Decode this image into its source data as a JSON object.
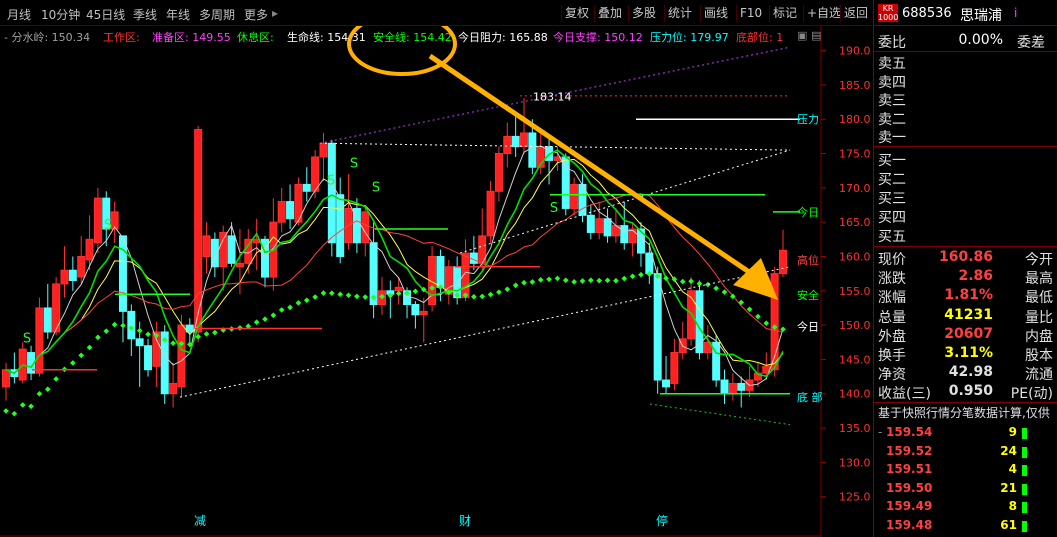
{
  "toolbar": {
    "periods": [
      "月线",
      "10分钟",
      "45日线",
      "季线",
      "年线",
      "多周期",
      "更多"
    ],
    "more_arrow": "▸",
    "buttons": [
      "复权",
      "叠加",
      "多股",
      "统计",
      "画线",
      "F10",
      "标记",
      "+自选",
      "返回"
    ]
  },
  "indicators": [
    {
      "text": "- 分水岭: 150.34",
      "color": "#a0a0a0"
    },
    {
      "text": "工作区:",
      "color": "#ff3030"
    },
    {
      "text": "准备区: 149.55",
      "color": "#ff40ff"
    },
    {
      "text": "休息区:",
      "color": "#00ff00"
    },
    {
      "text": "生命线: 154.31",
      "color": "#ffffff"
    },
    {
      "text": "安全线: 154.42",
      "color": "#00ff00"
    },
    {
      "text": "今日阻力: 165.88",
      "color": "#ffffff"
    },
    {
      "text": "今日支撑: 150.12",
      "color": "#ff40ff"
    },
    {
      "text": "压力位: 179.97",
      "color": "#00ffff"
    },
    {
      "text": "底部位: 1",
      "color": "#ff3030"
    }
  ],
  "chart_data": {
    "type": "candlestick",
    "ylim": [
      120,
      193
    ],
    "y_ticks": [
      "125.0",
      "130.0",
      "135.0",
      "140.0",
      "145.0",
      "150.0",
      "155.0",
      "160.0",
      "165.0",
      "170.0",
      "175.0",
      "180.0",
      "185.0",
      "190.0"
    ],
    "peak_label": "183.14",
    "bottom_labels": [
      "减",
      "财",
      "停"
    ],
    "line_labels": [
      {
        "text": "压力",
        "color": "#00ffff",
        "y": 180
      },
      {
        "text": "今日",
        "color": "#00ff00",
        "y": 166.5
      },
      {
        "text": "高位",
        "color": "#ff4040",
        "y": 159.5
      },
      {
        "text": "安全",
        "color": "#00ff00",
        "y": 154.4
      },
      {
        "text": "今日",
        "color": "#ffffff",
        "y": 149.8
      },
      {
        "text": "底 部",
        "color": "#00ffff",
        "y": 139.5
      }
    ],
    "signal_labels": [
      "S",
      "S",
      "S",
      "S",
      "S",
      "S"
    ],
    "candles": [
      {
        "o": 141.0,
        "c": 143.5,
        "h": 144.5,
        "l": 139.0
      },
      {
        "o": 143.5,
        "c": 142.5,
        "h": 146.0,
        "l": 141.5
      },
      {
        "o": 142.0,
        "c": 146.5,
        "h": 147.5,
        "l": 141.5
      },
      {
        "o": 146.0,
        "c": 143.0,
        "h": 147.0,
        "l": 142.0
      },
      {
        "o": 143.0,
        "c": 152.5,
        "h": 154.0,
        "l": 142.5
      },
      {
        "o": 152.5,
        "c": 149.0,
        "h": 156.0,
        "l": 148.0
      },
      {
        "o": 149.0,
        "c": 156.0,
        "h": 157.0,
        "l": 148.5
      },
      {
        "o": 156.0,
        "c": 158.0,
        "h": 161.5,
        "l": 154.0
      },
      {
        "o": 158.0,
        "c": 156.5,
        "h": 160.0,
        "l": 155.0
      },
      {
        "o": 157.0,
        "c": 160.0,
        "h": 163.0,
        "l": 156.0
      },
      {
        "o": 159.5,
        "c": 162.5,
        "h": 166.0,
        "l": 158.0
      },
      {
        "o": 162.0,
        "c": 168.5,
        "h": 170.0,
        "l": 160.5
      },
      {
        "o": 168.5,
        "c": 164.0,
        "h": 169.5,
        "l": 161.5
      },
      {
        "o": 164.0,
        "c": 166.5,
        "h": 168.0,
        "l": 162.0
      },
      {
        "o": 163.0,
        "c": 152.0,
        "h": 163.0,
        "l": 147.5
      },
      {
        "o": 152.0,
        "c": 148.0,
        "h": 153.0,
        "l": 145.5
      },
      {
        "o": 148.0,
        "c": 147.0,
        "h": 150.5,
        "l": 141.0
      },
      {
        "o": 147.0,
        "c": 143.5,
        "h": 148.0,
        "l": 142.5
      },
      {
        "o": 144.0,
        "c": 149.0,
        "h": 150.5,
        "l": 141.0
      },
      {
        "o": 149.0,
        "c": 140.0,
        "h": 150.0,
        "l": 138.5
      },
      {
        "o": 140.0,
        "c": 141.5,
        "h": 144.5,
        "l": 138.0
      },
      {
        "o": 141.0,
        "c": 150.0,
        "h": 151.5,
        "l": 139.5
      },
      {
        "o": 150.0,
        "c": 149.0,
        "h": 151.0,
        "l": 147.0
      },
      {
        "o": 149.0,
        "c": 178.5,
        "h": 179.0,
        "l": 147.5
      },
      {
        "o": 160.0,
        "c": 163.0,
        "h": 165.0,
        "l": 157.5
      },
      {
        "o": 162.5,
        "c": 158.5,
        "h": 163.5,
        "l": 157.0
      },
      {
        "o": 158.5,
        "c": 163.5,
        "h": 164.5,
        "l": 155.0
      },
      {
        "o": 163.0,
        "c": 159.0,
        "h": 165.0,
        "l": 158.5
      },
      {
        "o": 158.5,
        "c": 159.0,
        "h": 164.0,
        "l": 154.5
      },
      {
        "o": 159.0,
        "c": 162.5,
        "h": 164.0,
        "l": 157.5
      },
      {
        "o": 162.0,
        "c": 162.5,
        "h": 165.5,
        "l": 158.0
      },
      {
        "o": 162.5,
        "c": 157.0,
        "h": 163.0,
        "l": 155.5
      },
      {
        "o": 157.0,
        "c": 165.0,
        "h": 168.5,
        "l": 155.0
      },
      {
        "o": 165.0,
        "c": 168.0,
        "h": 170.0,
        "l": 163.5
      },
      {
        "o": 168.0,
        "c": 165.5,
        "h": 170.5,
        "l": 164.0
      },
      {
        "o": 165.0,
        "c": 170.5,
        "h": 171.5,
        "l": 164.5
      },
      {
        "o": 170.5,
        "c": 169.5,
        "h": 173.0,
        "l": 168.0
      },
      {
        "o": 169.5,
        "c": 174.5,
        "h": 175.5,
        "l": 168.5
      },
      {
        "o": 174.5,
        "c": 176.5,
        "h": 178.0,
        "l": 171.0
      },
      {
        "o": 176.5,
        "c": 162.0,
        "h": 177.0,
        "l": 160.0
      },
      {
        "o": 169.0,
        "c": 160.0,
        "h": 171.5,
        "l": 159.0
      },
      {
        "o": 162.0,
        "c": 167.0,
        "h": 172.0,
        "l": 161.0
      },
      {
        "o": 167.0,
        "c": 162.0,
        "h": 168.5,
        "l": 160.5
      },
      {
        "o": 162.0,
        "c": 166.5,
        "h": 167.5,
        "l": 160.0
      },
      {
        "o": 162.0,
        "c": 153.0,
        "h": 165.0,
        "l": 151.0
      },
      {
        "o": 153.0,
        "c": 155.0,
        "h": 157.0,
        "l": 151.5
      },
      {
        "o": 155.0,
        "c": 154.5,
        "h": 156.5,
        "l": 151.0
      },
      {
        "o": 155.0,
        "c": 155.5,
        "h": 157.0,
        "l": 153.0
      },
      {
        "o": 155.0,
        "c": 153.0,
        "h": 155.5,
        "l": 151.0
      },
      {
        "o": 153.0,
        "c": 151.5,
        "h": 153.5,
        "l": 149.5
      },
      {
        "o": 151.5,
        "c": 152.0,
        "h": 154.0,
        "l": 147.5
      },
      {
        "o": 153.0,
        "c": 160.0,
        "h": 161.5,
        "l": 152.0
      },
      {
        "o": 160.0,
        "c": 155.5,
        "h": 161.0,
        "l": 153.5
      },
      {
        "o": 154.5,
        "c": 158.5,
        "h": 159.5,
        "l": 153.0
      },
      {
        "o": 158.5,
        "c": 154.0,
        "h": 160.0,
        "l": 153.0
      },
      {
        "o": 154.0,
        "c": 160.5,
        "h": 162.5,
        "l": 153.5
      },
      {
        "o": 160.5,
        "c": 159.0,
        "h": 163.0,
        "l": 158.0
      },
      {
        "o": 159.0,
        "c": 163.0,
        "h": 167.0,
        "l": 158.0
      },
      {
        "o": 163.0,
        "c": 169.5,
        "h": 171.0,
        "l": 162.0
      },
      {
        "o": 169.5,
        "c": 175.0,
        "h": 176.0,
        "l": 168.0
      },
      {
        "o": 175.0,
        "c": 177.5,
        "h": 179.5,
        "l": 173.0
      },
      {
        "o": 177.5,
        "c": 176.0,
        "h": 181.0,
        "l": 174.5
      },
      {
        "o": 176.0,
        "c": 178.0,
        "h": 183.1,
        "l": 175.0
      },
      {
        "o": 178.0,
        "c": 173.0,
        "h": 180.0,
        "l": 172.0
      },
      {
        "o": 173.0,
        "c": 176.0,
        "h": 178.0,
        "l": 172.0
      },
      {
        "o": 176.0,
        "c": 174.0,
        "h": 177.5,
        "l": 170.5
      },
      {
        "o": 174.0,
        "c": 174.5,
        "h": 176.0,
        "l": 172.5
      },
      {
        "o": 174.5,
        "c": 167.0,
        "h": 175.0,
        "l": 166.0
      },
      {
        "o": 167.0,
        "c": 170.5,
        "h": 171.5,
        "l": 166.0
      },
      {
        "o": 170.5,
        "c": 166.0,
        "h": 172.0,
        "l": 165.0
      },
      {
        "o": 166.0,
        "c": 163.5,
        "h": 167.5,
        "l": 162.5
      },
      {
        "o": 163.5,
        "c": 165.5,
        "h": 168.0,
        "l": 162.5
      },
      {
        "o": 165.5,
        "c": 163.0,
        "h": 167.0,
        "l": 162.0
      },
      {
        "o": 163.0,
        "c": 164.5,
        "h": 167.0,
        "l": 162.0
      },
      {
        "o": 164.5,
        "c": 162.0,
        "h": 168.0,
        "l": 161.0
      },
      {
        "o": 162.0,
        "c": 164.0,
        "h": 165.0,
        "l": 160.0
      },
      {
        "o": 164.0,
        "c": 160.5,
        "h": 165.0,
        "l": 158.5
      },
      {
        "o": 160.5,
        "c": 157.5,
        "h": 162.0,
        "l": 156.0
      },
      {
        "o": 157.5,
        "c": 142.0,
        "h": 158.5,
        "l": 140.0
      },
      {
        "o": 142.0,
        "c": 141.0,
        "h": 145.5,
        "l": 140.0
      },
      {
        "o": 141.5,
        "c": 146.0,
        "h": 148.0,
        "l": 140.5
      },
      {
        "o": 146.0,
        "c": 148.0,
        "h": 150.5,
        "l": 145.0
      },
      {
        "o": 148.0,
        "c": 155.0,
        "h": 157.0,
        "l": 147.0
      },
      {
        "o": 155.0,
        "c": 146.0,
        "h": 156.5,
        "l": 145.0
      },
      {
        "o": 146.0,
        "c": 147.5,
        "h": 150.0,
        "l": 145.0
      },
      {
        "o": 147.5,
        "c": 142.0,
        "h": 148.5,
        "l": 141.0
      },
      {
        "o": 142.0,
        "c": 140.0,
        "h": 143.5,
        "l": 138.5
      },
      {
        "o": 140.0,
        "c": 141.5,
        "h": 143.0,
        "l": 139.0
      },
      {
        "o": 141.5,
        "c": 140.5,
        "h": 142.5,
        "l": 138.0
      },
      {
        "o": 140.5,
        "c": 142.0,
        "h": 144.0,
        "l": 139.5
      },
      {
        "o": 142.0,
        "c": 143.0,
        "h": 144.5,
        "l": 141.0
      },
      {
        "o": 143.0,
        "c": 144.0,
        "h": 146.0,
        "l": 142.0
      },
      {
        "o": 143.5,
        "c": 157.5,
        "h": 158.5,
        "l": 142.5
      },
      {
        "o": 157.5,
        "c": 160.9,
        "h": 163.9,
        "l": 157.0
      }
    ]
  },
  "stock": {
    "badge": "KR\n1000",
    "code": "688536",
    "name": "思瑞浦",
    "flag": "i",
    "weibi_label": "委比",
    "weibi": "0.00%",
    "weicha_label": "委差",
    "sell": [
      "卖五",
      "卖四",
      "卖三",
      "卖二",
      "卖一"
    ],
    "buy": [
      "买一",
      "买二",
      "买三",
      "买四",
      "买五"
    ],
    "stats": [
      {
        "l": "现价",
        "v": "160.86",
        "vc": "#ff4040",
        "r": "今开",
        "rv": ""
      },
      {
        "l": "涨跌",
        "v": "2.86",
        "vc": "#ff4040",
        "r": "最高",
        "rv": ""
      },
      {
        "l": "涨幅",
        "v": "1.81%",
        "vc": "#ff4040",
        "r": "最低",
        "rv": ""
      },
      {
        "l": "总量",
        "v": "41231",
        "vc": "#ffff00",
        "r": "量比",
        "rv": ""
      },
      {
        "l": "外盘",
        "v": "20607",
        "vc": "#ff4040",
        "r": "内盘",
        "rv": ""
      },
      {
        "l": "换手",
        "v": "3.11%",
        "vc": "#ffff00",
        "r": "股本",
        "rv": ""
      },
      {
        "l": "净资",
        "v": "42.98",
        "vc": "#e0e0e0",
        "r": "流通",
        "rv": ""
      },
      {
        "l": "收益(三)",
        "v": "0.950",
        "vc": "#e0e0e0",
        "r": "PE(动)",
        "rv": ""
      }
    ],
    "note": "基于快照行情分笔数据计算,仅供",
    "ticks": [
      {
        "p": "159.54",
        "v": "9",
        "mark": "-"
      },
      {
        "p": "159.52",
        "v": "24",
        "mark": ""
      },
      {
        "p": "159.51",
        "v": "4",
        "mark": ""
      },
      {
        "p": "159.50",
        "v": "21",
        "mark": ""
      },
      {
        "p": "159.49",
        "v": "8",
        "mark": ""
      },
      {
        "p": "159.48",
        "v": "61",
        "mark": ""
      }
    ]
  }
}
